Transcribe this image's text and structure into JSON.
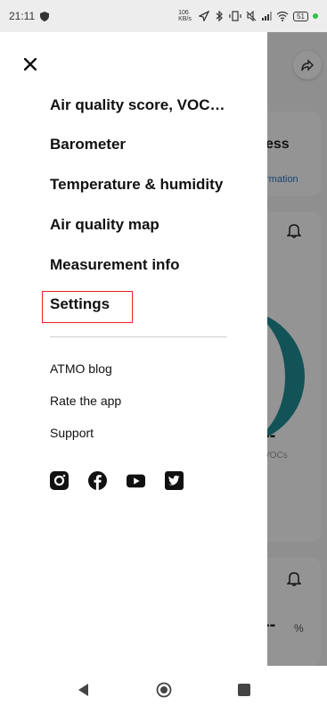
{
  "status_bar": {
    "time": "21:11",
    "speed_label": "106 KB/s",
    "battery": "51"
  },
  "background": {
    "card_title_fragment": "ess",
    "card_link_fragment": "rmation",
    "gauge_label": "Good",
    "gauge_value": "--",
    "vocs_label": "VOCs",
    "humidity_value": "--",
    "humidity_unit": "%"
  },
  "drawer": {
    "close_icon": "close-icon",
    "menu": [
      {
        "label": "Air quality score, VOC…"
      },
      {
        "label": "Barometer"
      },
      {
        "label": "Temperature & humidity"
      },
      {
        "label": "Air quality map"
      },
      {
        "label": "Measurement info"
      },
      {
        "label": "Settings",
        "highlighted": true
      }
    ],
    "links": [
      {
        "label": "ATMO blog"
      },
      {
        "label": "Rate the app"
      },
      {
        "label": "Support"
      }
    ],
    "socials": [
      "instagram-icon",
      "facebook-icon",
      "youtube-icon",
      "twitter-icon"
    ]
  },
  "colors": {
    "highlight_outline": "#e32222",
    "gauge": "#1f8f96",
    "link": "#2a78c2"
  }
}
